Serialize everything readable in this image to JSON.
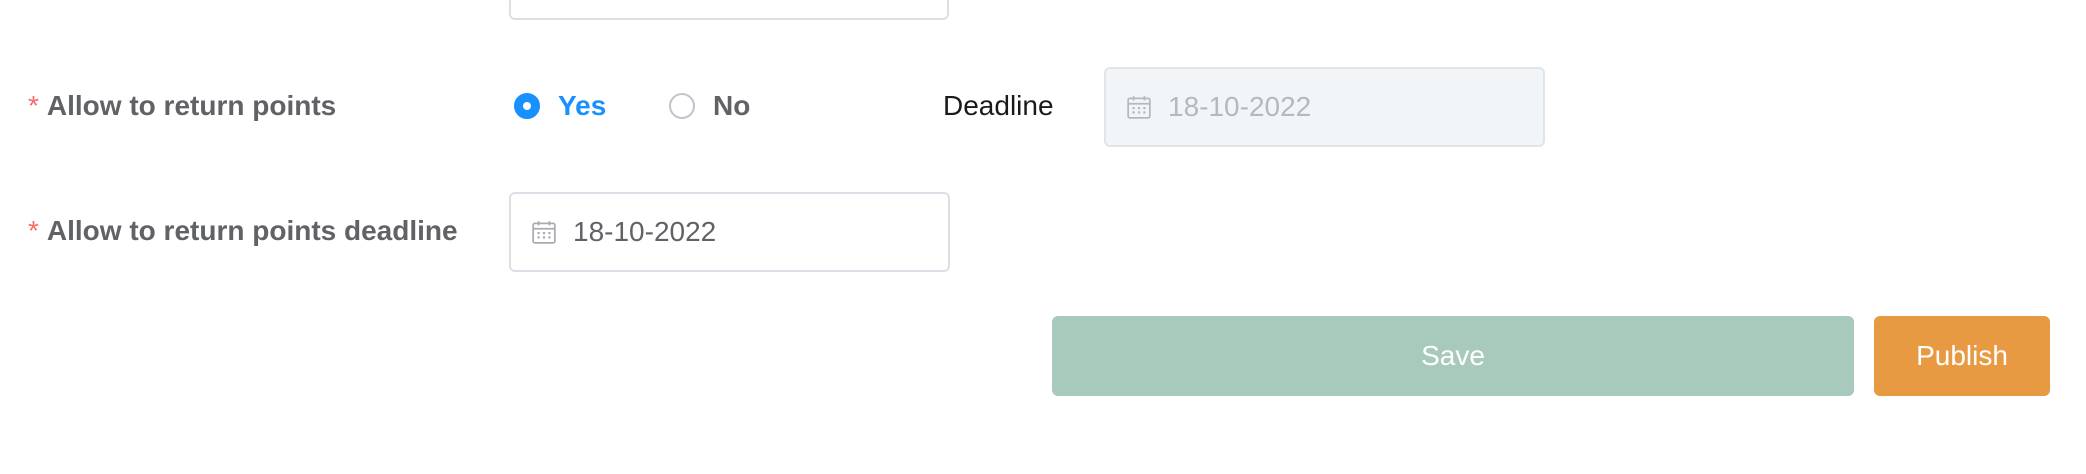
{
  "form": {
    "return_points": {
      "required_mark": "*",
      "label": "Allow to return points",
      "options": [
        {
          "label": "Yes",
          "checked": true
        },
        {
          "label": "No",
          "checked": false
        }
      ],
      "deadline_label": "Deadline",
      "deadline_value": "18-10-2022",
      "deadline_disabled": true
    },
    "return_deadline": {
      "required_mark": "*",
      "label": "Allow to return points deadline",
      "value": "18-10-2022"
    }
  },
  "actions": {
    "save_label": "Save",
    "publish_label": "Publish"
  },
  "colors": {
    "primary": "#1890ff",
    "required": "#f56c6c",
    "save_button": "#a8cabd",
    "publish_button": "#e89a43"
  },
  "icons": {
    "date": "calendar-icon"
  }
}
